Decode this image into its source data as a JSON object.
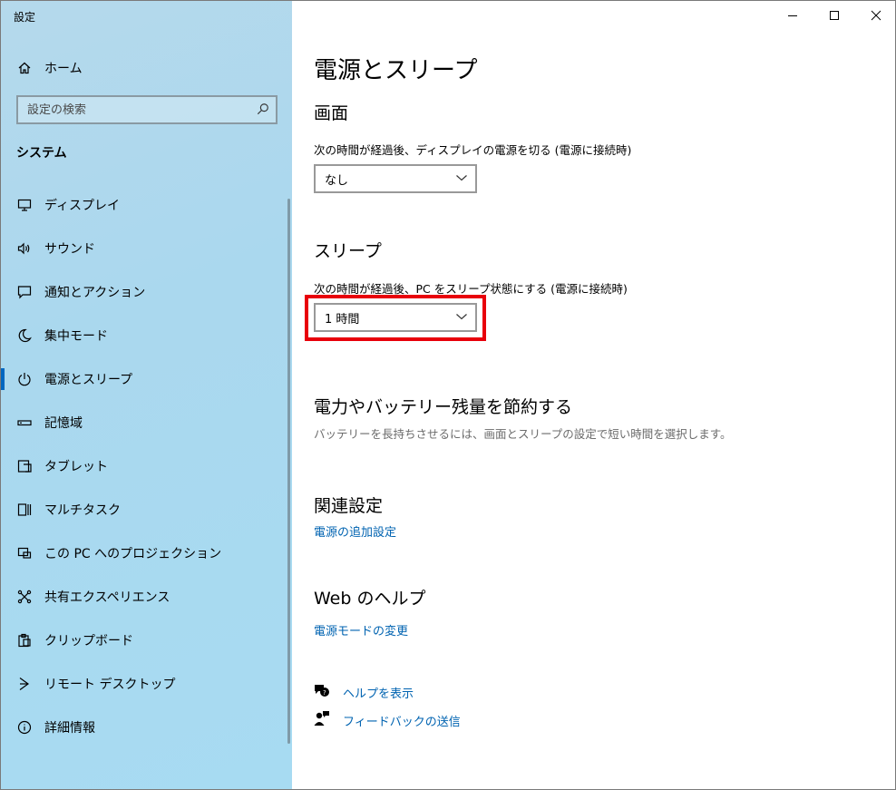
{
  "window": {
    "title": "設定",
    "minimize_label": "Minimize",
    "maximize_label": "Maximize",
    "close_label": "Close"
  },
  "sidebar": {
    "home": {
      "label": "ホーム",
      "icon": "home-icon"
    },
    "search": {
      "placeholder": "設定の検索"
    },
    "section": "システム",
    "items": [
      {
        "label": "ディスプレイ",
        "icon": "display-icon"
      },
      {
        "label": "サウンド",
        "icon": "sound-icon"
      },
      {
        "label": "通知とアクション",
        "icon": "notification-icon"
      },
      {
        "label": "集中モード",
        "icon": "moon-icon"
      },
      {
        "label": "電源とスリープ",
        "icon": "power-icon",
        "selected": true
      },
      {
        "label": "記憶域",
        "icon": "storage-icon"
      },
      {
        "label": "タブレット",
        "icon": "tablet-icon"
      },
      {
        "label": "マルチタスク",
        "icon": "multitask-icon"
      },
      {
        "label": "この PC へのプロジェクション",
        "icon": "projection-icon"
      },
      {
        "label": "共有エクスペリエンス",
        "icon": "share-icon"
      },
      {
        "label": "クリップボード",
        "icon": "clipboard-icon"
      },
      {
        "label": "リモート デスクトップ",
        "icon": "remote-desktop-icon"
      },
      {
        "label": "詳細情報",
        "icon": "info-icon"
      }
    ]
  },
  "main": {
    "title": "電源とスリープ",
    "screen": {
      "heading": "画面",
      "description": "次の時間が経過後、ディスプレイの電源を切る (電源に接続時)",
      "value": "なし"
    },
    "sleep": {
      "heading": "スリープ",
      "description": "次の時間が経過後、PC をスリープ状態にする (電源に接続時)",
      "value": "1 時間"
    },
    "battery": {
      "heading": "電力やバッテリー残量を節約する",
      "description": "バッテリーを長持ちさせるには、画面とスリープの設定で短い時間を選択します。"
    },
    "related": {
      "heading": "関連設定",
      "link": "電源の追加設定"
    },
    "web_help": {
      "heading": "Web のヘルプ",
      "link": "電源モードの変更"
    },
    "help": {
      "show_help": "ヘルプを表示",
      "feedback": "フィードバックの送信"
    }
  },
  "colors": {
    "accent": "#0067c0",
    "link": "#0063b1",
    "highlight": "#e8000b"
  }
}
